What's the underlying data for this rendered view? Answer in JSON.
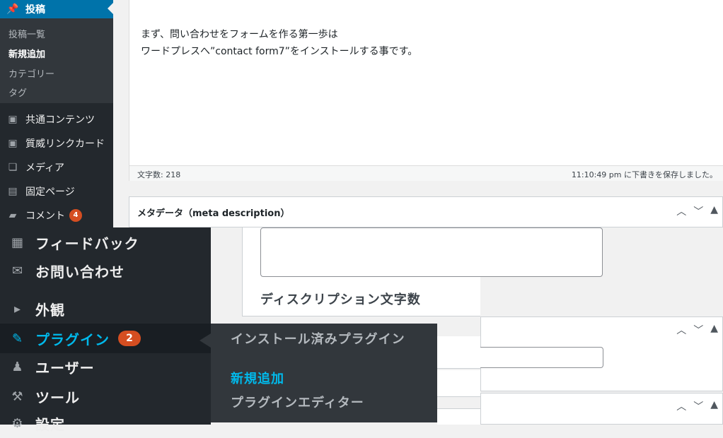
{
  "sidebar": {
    "posts_label": "投稿",
    "submenu": [
      "投稿一覧",
      "新規追加",
      "カテゴリー",
      "タグ"
    ],
    "items": [
      {
        "label": "共通コンテンツ",
        "icon": "puzzle-icon"
      },
      {
        "label": "質威リンクカード",
        "icon": "puzzle-icon"
      },
      {
        "label": "メディア",
        "icon": "media-icon"
      },
      {
        "label": "固定ページ",
        "icon": "page-icon"
      },
      {
        "label": "コメント",
        "icon": "comment-icon",
        "badge": "4"
      }
    ]
  },
  "editor": {
    "line1": "まず、問い合わせをフォームを作る第一歩は",
    "line2": "ワードプレスへ”contact form7”をインストールする事です。",
    "word_count": "文字数: 218",
    "autosave": "11:10:49 pm に下書きを保存しました。"
  },
  "metabox": {
    "title": "メタデータ（meta description）",
    "description_count_label": "ディスクリプション文字数"
  },
  "zoom_menu": {
    "items": [
      {
        "label": "フィードバック"
      },
      {
        "label": "お問い合わせ"
      },
      {
        "label": "外観"
      },
      {
        "label": "プラグイン",
        "badge": "2"
      },
      {
        "label": "ユーザー"
      },
      {
        "label": "ツール"
      },
      {
        "label": "設定"
      }
    ],
    "flyout": [
      "インストール済みプラグイン",
      "新規追加",
      "プラグインエディター"
    ]
  },
  "colors": {
    "accent": "#0073aa",
    "highlight": "#00b9eb",
    "badge": "#d54e21",
    "sidebar": "#23282d"
  }
}
